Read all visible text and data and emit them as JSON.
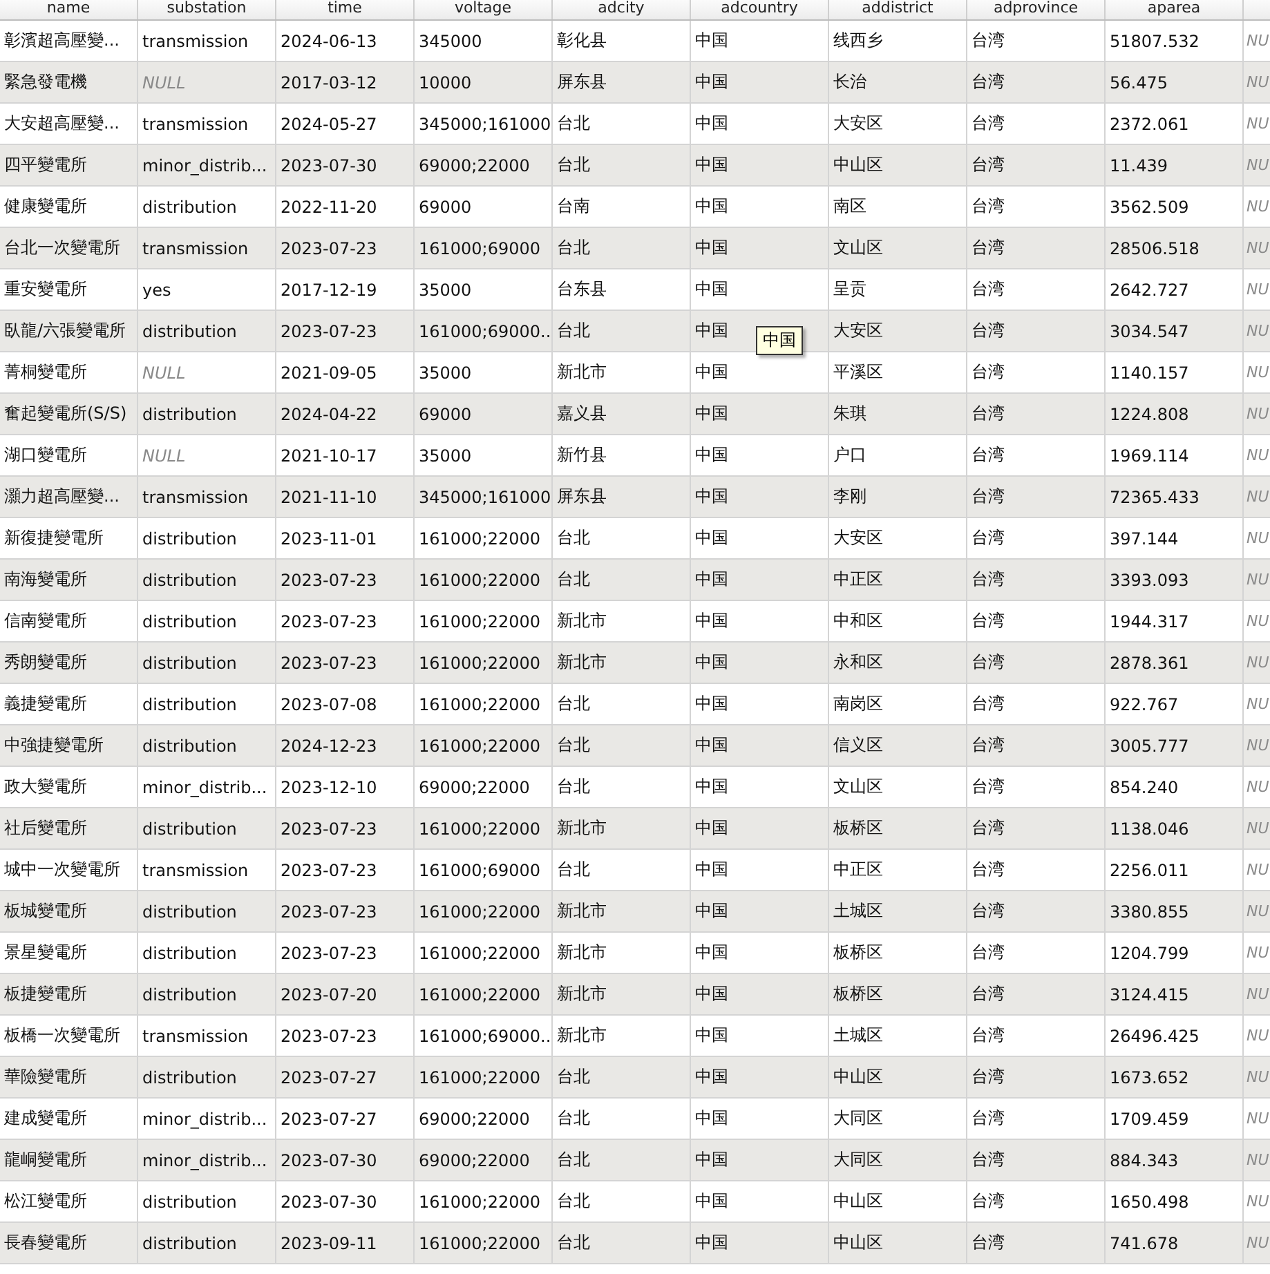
{
  "columns": [
    {
      "label": "name"
    },
    {
      "label": "substation"
    },
    {
      "label": "time"
    },
    {
      "label": "voltage"
    },
    {
      "label": "adcity"
    },
    {
      "label": "adcountry"
    },
    {
      "label": "addistrict"
    },
    {
      "label": "adprovince"
    },
    {
      "label": "aparea"
    }
  ],
  "rows": [
    {
      "cells": [
        "彰濱超高壓變...",
        "transmission",
        "2024-06-13",
        "345000",
        "彰化县",
        "中国",
        "线西乡",
        "台湾",
        "51807.532",
        {
          "text": "NU",
          "is_null": true
        }
      ]
    },
    {
      "cells": [
        "緊急發電機",
        {
          "text": "NULL",
          "is_null": true
        },
        "2017-03-12",
        "10000",
        "屏东县",
        "中国",
        "长治",
        "台湾",
        "56.475",
        {
          "text": "NU",
          "is_null": true
        }
      ]
    },
    {
      "cells": [
        "大安超高壓變...",
        "transmission",
        "2024-05-27",
        "345000;161000",
        "台北",
        "中国",
        "大安区",
        "台湾",
        "2372.061",
        {
          "text": "NU",
          "is_null": true
        }
      ]
    },
    {
      "cells": [
        "四平變電所",
        "minor_distrib...",
        "2023-07-30",
        "69000;22000",
        "台北",
        "中国",
        "中山区",
        "台湾",
        "11.439",
        {
          "text": "NU",
          "is_null": true
        }
      ]
    },
    {
      "cells": [
        "健康變電所",
        "distribution",
        "2022-11-20",
        "69000",
        "台南",
        "中国",
        "南区",
        "台湾",
        "3562.509",
        {
          "text": "NU",
          "is_null": true
        }
      ]
    },
    {
      "cells": [
        "台北一次變電所",
        "transmission",
        "2023-07-23",
        "161000;69000",
        "台北",
        "中国",
        "文山区",
        "台湾",
        "28506.518",
        {
          "text": "NU",
          "is_null": true
        }
      ]
    },
    {
      "cells": [
        "重安變電所",
        "yes",
        "2017-12-19",
        "35000",
        "台东县",
        "中国",
        "呈贡",
        "台湾",
        "2642.727",
        {
          "text": "NU",
          "is_null": true
        }
      ]
    },
    {
      "cells": [
        "臥龍/六張變電所",
        "distribution",
        "2023-07-23",
        "161000;69000...",
        "台北",
        "中国",
        "大安区",
        "台湾",
        "3034.547",
        {
          "text": "NU",
          "is_null": true
        }
      ]
    },
    {
      "cells": [
        "菁桐變電所",
        {
          "text": "NULL",
          "is_null": true
        },
        "2021-09-05",
        "35000",
        "新北市",
        "中国",
        "平溪区",
        "台湾",
        "1140.157",
        {
          "text": "NU",
          "is_null": true
        }
      ]
    },
    {
      "cells": [
        "奮起變電所(S/S)",
        "distribution",
        "2024-04-22",
        "69000",
        "嘉义县",
        "中国",
        "朱琪",
        "台湾",
        "1224.808",
        {
          "text": "NU",
          "is_null": true
        }
      ]
    },
    {
      "cells": [
        "湖口變電所",
        {
          "text": "NULL",
          "is_null": true
        },
        "2021-10-17",
        "35000",
        "新竹县",
        "中国",
        "户口",
        "台湾",
        "1969.114",
        {
          "text": "NU",
          "is_null": true
        }
      ]
    },
    {
      "cells": [
        "灝力超高壓變...",
        "transmission",
        "2021-11-10",
        "345000;161000",
        "屏东县",
        "中国",
        "李刚",
        "台湾",
        "72365.433",
        {
          "text": "NU",
          "is_null": true
        }
      ]
    },
    {
      "cells": [
        "新復捷變電所",
        "distribution",
        "2023-11-01",
        "161000;22000",
        "台北",
        "中国",
        "大安区",
        "台湾",
        "397.144",
        {
          "text": "NU",
          "is_null": true
        }
      ]
    },
    {
      "cells": [
        "南海變電所",
        "distribution",
        "2023-07-23",
        "161000;22000",
        "台北",
        "中国",
        "中正区",
        "台湾",
        "3393.093",
        {
          "text": "NU",
          "is_null": true
        }
      ]
    },
    {
      "cells": [
        "信南變電所",
        "distribution",
        "2023-07-23",
        "161000;22000",
        "新北市",
        "中国",
        "中和区",
        "台湾",
        "1944.317",
        {
          "text": "NU",
          "is_null": true
        }
      ]
    },
    {
      "cells": [
        "秀朗變電所",
        "distribution",
        "2023-07-23",
        "161000;22000",
        "新北市",
        "中国",
        "永和区",
        "台湾",
        "2878.361",
        {
          "text": "NU",
          "is_null": true
        }
      ]
    },
    {
      "cells": [
        "義捷變電所",
        "distribution",
        "2023-07-08",
        "161000;22000",
        "台北",
        "中国",
        "南岗区",
        "台湾",
        "922.767",
        {
          "text": "NU",
          "is_null": true
        }
      ]
    },
    {
      "cells": [
        "中強捷變電所",
        "distribution",
        "2024-12-23",
        "161000;22000",
        "台北",
        "中国",
        "信义区",
        "台湾",
        "3005.777",
        {
          "text": "NU",
          "is_null": true
        }
      ]
    },
    {
      "cells": [
        "政大變電所",
        "minor_distrib...",
        "2023-12-10",
        "69000;22000",
        "台北",
        "中国",
        "文山区",
        "台湾",
        "854.240",
        {
          "text": "NU",
          "is_null": true
        }
      ]
    },
    {
      "cells": [
        "社后變電所",
        "distribution",
        "2023-07-23",
        "161000;22000",
        "新北市",
        "中国",
        "板桥区",
        "台湾",
        "1138.046",
        {
          "text": "NU",
          "is_null": true
        }
      ]
    },
    {
      "cells": [
        "城中一次變電所",
        "transmission",
        "2023-07-23",
        "161000;69000",
        "台北",
        "中国",
        "中正区",
        "台湾",
        "2256.011",
        {
          "text": "NU",
          "is_null": true
        }
      ]
    },
    {
      "cells": [
        "板城變電所",
        "distribution",
        "2023-07-23",
        "161000;22000",
        "新北市",
        "中国",
        "土城区",
        "台湾",
        "3380.855",
        {
          "text": "NU",
          "is_null": true
        }
      ]
    },
    {
      "cells": [
        "景星變電所",
        "distribution",
        "2023-07-23",
        "161000;22000",
        "新北市",
        "中国",
        "板桥区",
        "台湾",
        "1204.799",
        {
          "text": "NU",
          "is_null": true
        }
      ]
    },
    {
      "cells": [
        "板捷變電所",
        "distribution",
        "2023-07-20",
        "161000;22000",
        "新北市",
        "中国",
        "板桥区",
        "台湾",
        "3124.415",
        {
          "text": "NU",
          "is_null": true
        }
      ]
    },
    {
      "cells": [
        "板橋一次變電所",
        "transmission",
        "2023-07-23",
        "161000;69000...",
        "新北市",
        "中国",
        "土城区",
        "台湾",
        "26496.425",
        {
          "text": "NU",
          "is_null": true
        }
      ]
    },
    {
      "cells": [
        "華險變電所",
        "distribution",
        "2023-07-27",
        "161000;22000",
        "台北",
        "中国",
        "中山区",
        "台湾",
        "1673.652",
        {
          "text": "NU",
          "is_null": true
        }
      ]
    },
    {
      "cells": [
        "建成變電所",
        "minor_distrib...",
        "2023-07-27",
        "69000;22000",
        "台北",
        "中国",
        "大同区",
        "台湾",
        "1709.459",
        {
          "text": "NU",
          "is_null": true
        }
      ]
    },
    {
      "cells": [
        "龍峒變電所",
        "minor_distrib...",
        "2023-07-30",
        "69000;22000",
        "台北",
        "中国",
        "大同区",
        "台湾",
        "884.343",
        {
          "text": "NU",
          "is_null": true
        }
      ]
    },
    {
      "cells": [
        "松江變電所",
        "distribution",
        "2023-07-30",
        "161000;22000",
        "台北",
        "中国",
        "中山区",
        "台湾",
        "1650.498",
        {
          "text": "NU",
          "is_null": true
        }
      ]
    },
    {
      "cells": [
        "長春變電所",
        "distribution",
        "2023-09-11",
        "161000;22000",
        "台北",
        "中国",
        "中山区",
        "台湾",
        "741.678",
        {
          "text": "NU",
          "is_null": true
        }
      ]
    }
  ],
  "tooltip": {
    "text": "中国"
  }
}
